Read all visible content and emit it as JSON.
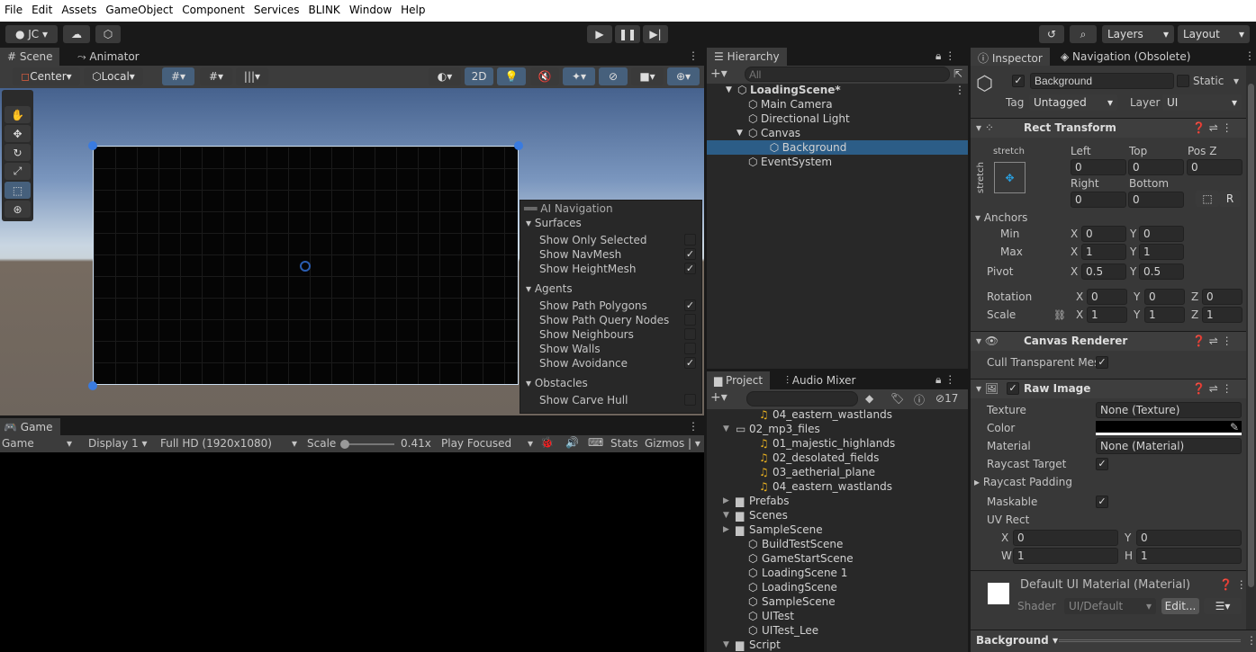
{
  "menu": [
    "File",
    "Edit",
    "Assets",
    "GameObject",
    "Component",
    "Services",
    "BLINK",
    "Window",
    "Help"
  ],
  "toolbar": {
    "account": "JC",
    "play_icon": "play-icon",
    "pause_icon": "pause-icon",
    "step_icon": "step-icon",
    "layers": "Layers",
    "layout": "Layout"
  },
  "scene": {
    "tab_scene": "Scene",
    "tab_animator": "Animator",
    "pivot": "Center",
    "space": "Local",
    "mode_2d": "2D"
  },
  "ai_nav": {
    "title": "AI Navigation",
    "sections": [
      {
        "label": "Surfaces",
        "items": [
          {
            "label": "Show Only Selected",
            "checked": false
          },
          {
            "label": "Show NavMesh",
            "checked": true
          },
          {
            "label": "Show HeightMesh",
            "checked": true
          }
        ]
      },
      {
        "label": "Agents",
        "items": [
          {
            "label": "Show Path Polygons",
            "checked": true
          },
          {
            "label": "Show Path Query Nodes",
            "checked": false
          },
          {
            "label": "Show Neighbours",
            "checked": false
          },
          {
            "label": "Show Walls",
            "checked": false
          },
          {
            "label": "Show Avoidance",
            "checked": true
          }
        ]
      },
      {
        "label": "Obstacles",
        "items": [
          {
            "label": "Show Carve Hull",
            "checked": false
          }
        ]
      }
    ]
  },
  "game": {
    "tab": "Game",
    "view": "Game",
    "display": "Display 1",
    "resolution": "Full HD (1920x1080)",
    "scale_label": "Scale",
    "scale_value": "0.41x",
    "play_mode": "Play Focused",
    "stats": "Stats",
    "gizmos": "Gizmos"
  },
  "hierarchy": {
    "tab": "Hierarchy",
    "search_placeholder": "All",
    "items": [
      {
        "label": "LoadingScene*",
        "depth": 0,
        "type": "scene",
        "expanded": true
      },
      {
        "label": "Main Camera",
        "depth": 1,
        "type": "object"
      },
      {
        "label": "Directional Light",
        "depth": 1,
        "type": "object"
      },
      {
        "label": "Canvas",
        "depth": 1,
        "type": "object",
        "expanded": true
      },
      {
        "label": "Background",
        "depth": 2,
        "type": "object",
        "selected": true
      },
      {
        "label": "EventSystem",
        "depth": 1,
        "type": "object"
      }
    ]
  },
  "project": {
    "tab_project": "Project",
    "tab_mixer": "Audio Mixer",
    "hidden_count": "17",
    "items": [
      {
        "label": "04_eastern_wastlands",
        "indent": 3,
        "type": "audio"
      },
      {
        "label": "02_mp3_files",
        "indent": 2,
        "type": "folder-open",
        "arrow": "down"
      },
      {
        "label": "01_majestic_highlands",
        "indent": 3,
        "type": "audio"
      },
      {
        "label": "02_desolated_fields",
        "indent": 3,
        "type": "audio"
      },
      {
        "label": "03_aetherial_plane",
        "indent": 3,
        "type": "audio"
      },
      {
        "label": "04_eastern_wastlands",
        "indent": 3,
        "type": "audio"
      },
      {
        "label": "Prefabs",
        "indent": 1,
        "type": "folder",
        "arrow": "right"
      },
      {
        "label": "Scenes",
        "indent": 1,
        "type": "folder",
        "arrow": "down"
      },
      {
        "label": "SampleScene",
        "indent": 2,
        "type": "folder",
        "arrow": "right"
      },
      {
        "label": "BuildTestScene",
        "indent": 2,
        "type": "scene"
      },
      {
        "label": "GameStartScene",
        "indent": 2,
        "type": "scene"
      },
      {
        "label": "LoadingScene 1",
        "indent": 2,
        "type": "scene"
      },
      {
        "label": "LoadingScene",
        "indent": 2,
        "type": "scene"
      },
      {
        "label": "SampleScene",
        "indent": 2,
        "type": "scene"
      },
      {
        "label": "UITest",
        "indent": 2,
        "type": "scene"
      },
      {
        "label": "UITest_Lee",
        "indent": 2,
        "type": "scene"
      },
      {
        "label": "Script",
        "indent": 1,
        "type": "folder",
        "arrow": "down"
      }
    ]
  },
  "inspector": {
    "tab": "Inspector",
    "tab_nav": "Navigation (Obsolete)",
    "name": "Background",
    "active": true,
    "static_label": "Static",
    "tag_label": "Tag",
    "tag": "Untagged",
    "layer_label": "Layer",
    "layer": "UI",
    "rect": {
      "title": "Rect Transform",
      "stretch_h": "stretch",
      "stretch_v": "stretch",
      "left_l": "Left",
      "left": "0",
      "top_l": "Top",
      "top": "0",
      "posz_l": "Pos Z",
      "posz": "0",
      "right_l": "Right",
      "right": "0",
      "bottom_l": "Bottom",
      "bottom": "0",
      "r_btn": "R",
      "anchors": "Anchors",
      "min": "Min",
      "max": "Max",
      "min_x": "0",
      "min_y": "0",
      "max_x": "1",
      "max_y": "1",
      "pivot": "Pivot",
      "pivot_x": "0.5",
      "pivot_y": "0.5",
      "rotation": "Rotation",
      "rot_x": "0",
      "rot_y": "0",
      "rot_z": "0",
      "scale": "Scale",
      "sc_x": "1",
      "sc_y": "1",
      "sc_z": "1",
      "X": "X",
      "Y": "Y",
      "Z": "Z"
    },
    "canvas_renderer": {
      "title": "Canvas Renderer",
      "cull": "Cull Transparent Mes",
      "cull_checked": true
    },
    "raw_image": {
      "title": "Raw Image",
      "texture_l": "Texture",
      "texture": "None (Texture)",
      "color_l": "Color",
      "color": "#000000",
      "material_l": "Material",
      "material": "None (Material)",
      "raycast_l": "Raycast Target",
      "raycast_padding": "Raycast Padding",
      "maskable_l": "Maskable",
      "uv_l": "UV Rect",
      "uv_x": "0",
      "uv_y": "0",
      "uv_w": "1",
      "uv_h": "1",
      "W": "W",
      "H": "H"
    },
    "material": {
      "title": "Default UI Material (Material)",
      "shader_l": "Shader",
      "shader": "UI/Default",
      "edit": "Edit..."
    },
    "footer": "Background"
  }
}
